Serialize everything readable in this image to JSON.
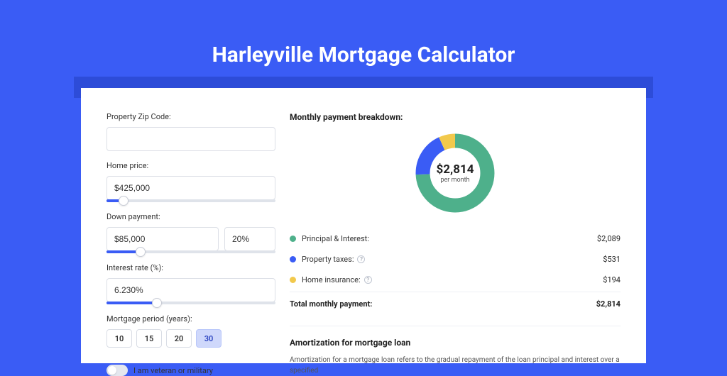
{
  "page": {
    "title": "Harleyville Mortgage Calculator"
  },
  "form": {
    "zip": {
      "label": "Property Zip Code:",
      "value": ""
    },
    "price": {
      "label": "Home price:",
      "value": "$425,000",
      "slider_pct": 10
    },
    "down": {
      "label": "Down payment:",
      "value": "$85,000",
      "pct": "20%",
      "slider_pct": 20
    },
    "rate": {
      "label": "Interest rate (%):",
      "value": "6.230%",
      "slider_pct": 30
    },
    "period": {
      "label": "Mortgage period (years):",
      "options": [
        "10",
        "15",
        "20",
        "30"
      ],
      "selected": "30"
    },
    "veteran": {
      "label": "I am veteran or military",
      "on": false
    }
  },
  "breakdown": {
    "title": "Monthly payment breakdown:",
    "center_amount": "$2,814",
    "center_sub": "per month",
    "items": [
      {
        "name": "Principal & Interest:",
        "value": "$2,089",
        "color": "#4eb08b",
        "info": false
      },
      {
        "name": "Property taxes:",
        "value": "$531",
        "color": "#3a5cf5",
        "info": true
      },
      {
        "name": "Home insurance:",
        "value": "$194",
        "color": "#f2c94c",
        "info": true
      }
    ],
    "total": {
      "label": "Total monthly payment:",
      "value": "$2,814"
    }
  },
  "chart_data": {
    "type": "pie",
    "title": "Monthly payment breakdown",
    "series": [
      {
        "name": "Principal & Interest",
        "value": 2089,
        "color": "#4eb08b"
      },
      {
        "name": "Property taxes",
        "value": 531,
        "color": "#3a5cf5"
      },
      {
        "name": "Home insurance",
        "value": 194,
        "color": "#f2c94c"
      }
    ],
    "total": 2814,
    "center_label": "$2,814 per month"
  },
  "amort": {
    "title": "Amortization for mortgage loan",
    "body": "Amortization for a mortgage loan refers to the gradual repayment of the loan principal and interest over a specified"
  }
}
